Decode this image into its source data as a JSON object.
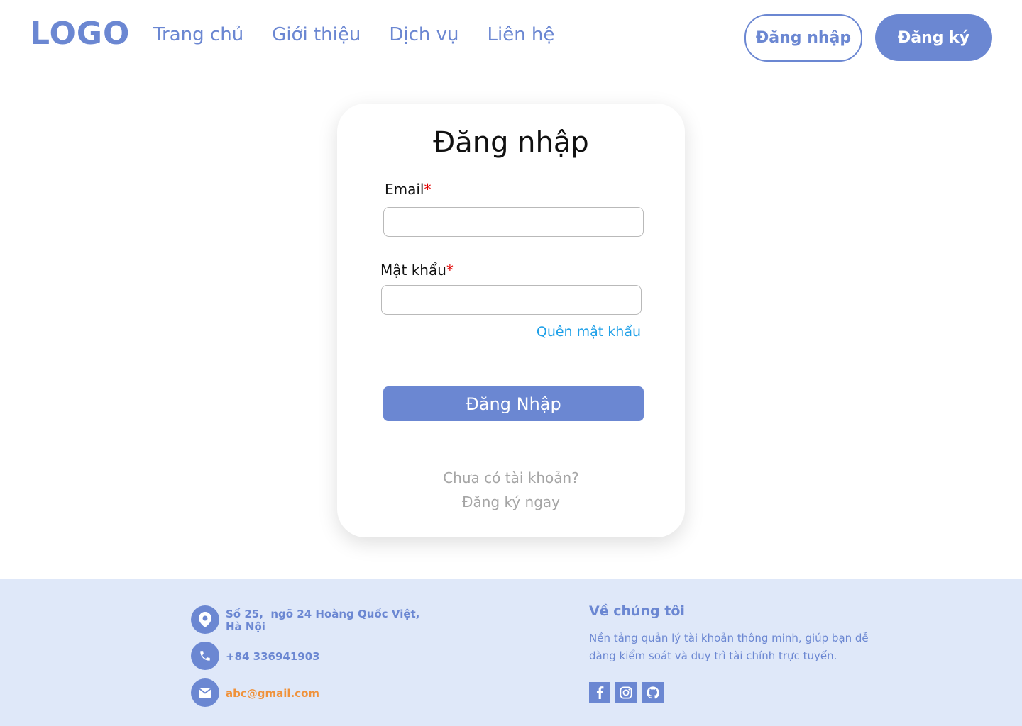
{
  "header": {
    "logo": "LOGO",
    "nav": [
      "Trang chủ",
      "Giới thiệu",
      "Dịch vụ",
      "Liên hệ"
    ],
    "login_label": "Đăng nhập",
    "register_label": "Đăng ký"
  },
  "form": {
    "title": "Đăng nhập",
    "email_label": "Email",
    "password_label": "Mật khẩu",
    "required_mark": "*",
    "email_value": "",
    "password_value": "",
    "forgot_label": "Quên mật khẩu",
    "submit_label": "Đăng Nhập",
    "no_account": "Chưa có tài khoản?",
    "register_link": "Đăng ký ngay"
  },
  "footer": {
    "address_line1": "Số 25,  ngõ 24 Hoàng Quốc Việt,",
    "address_line2": "Hà Nội",
    "phone": "+84 336941903",
    "email": "abc@gmail.com",
    "about_title": "Về chúng tôi",
    "about_desc": "Nền tảng quản lý tài khoản thông minh, giúp bạn dễ dàng kiểm soát và duy trì tài chính trực tuyến.",
    "socials": [
      "facebook-icon",
      "instagram-icon",
      "github-icon"
    ]
  },
  "colors": {
    "primary": "#6b87d2",
    "footer_bg": "#dfe8f9",
    "link_blue": "#1ea0e8",
    "email_orange": "#f0923b",
    "required_red": "#e20000"
  }
}
